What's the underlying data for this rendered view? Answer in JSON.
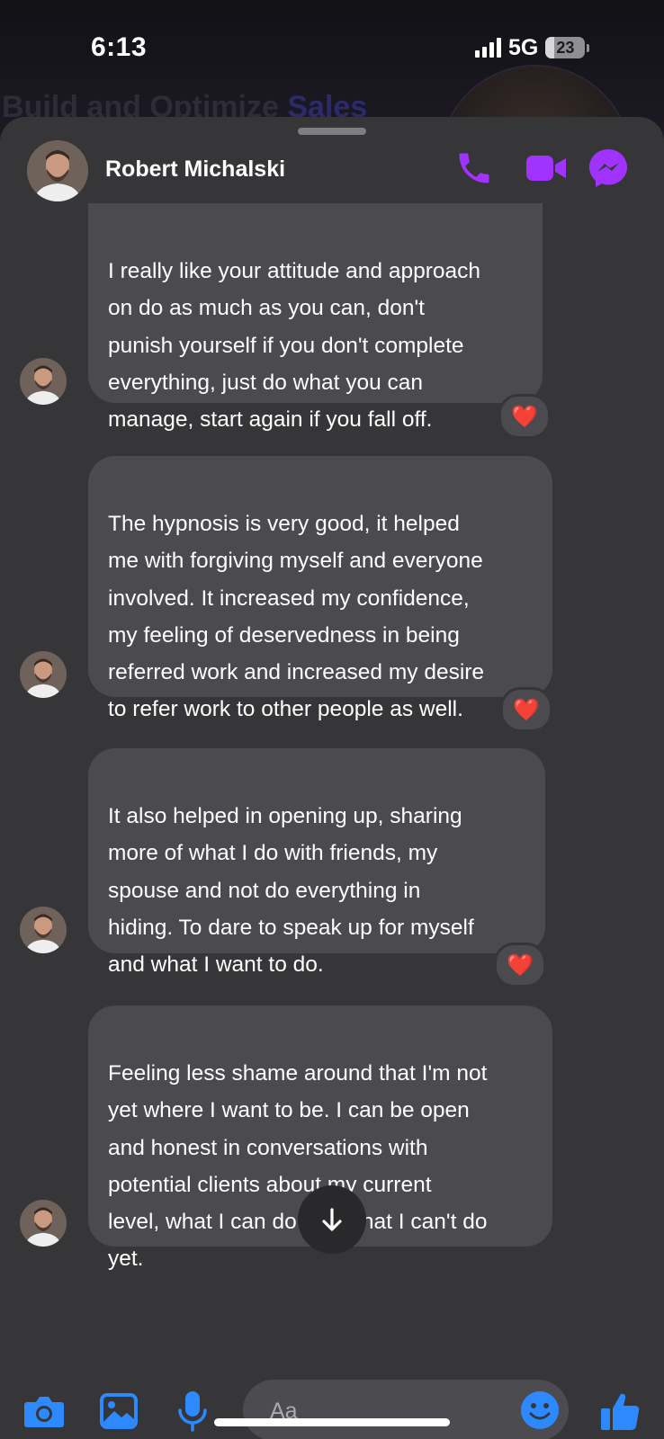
{
  "status_bar": {
    "time": "6:13",
    "network": "5G",
    "battery": "23",
    "battery_fraction": 0.23
  },
  "background_page": {
    "title_plain": "Build and Optimize ",
    "title_accent": "Sales"
  },
  "header": {
    "contact_name": "Robert Michalski"
  },
  "messages": [
    {
      "text": "I really like your attitude and approach\non do as much as you can, don't\npunish yourself if you don't complete\neverything, just do what you can\nmanage, start again if you fall off.",
      "reaction": "❤️"
    },
    {
      "text": "The hypnosis is very good, it helped\nme with forgiving myself and everyone\ninvolved. It increased my confidence,\nmy feeling of deservedness in being\nreferred work and increased my desire\nto refer work to other people as well.",
      "reaction": "❤️"
    },
    {
      "text": "It also helped in opening up, sharing\nmore of what I do with friends, my\nspouse and not do everything in\nhiding. To dare to speak up for myself\nand what I want to do.",
      "reaction": "❤️"
    },
    {
      "text": "Feeling less shame around that I'm not\nyet where I want to be. I can be open\nand honest in conversations  with\npotential clients about my current\nlevel, what I can do and what I can't do\nyet."
    }
  ],
  "composer": {
    "placeholder": "Aa"
  },
  "colors": {
    "accent_purple": "#a033ff",
    "accent_blue": "#2e89ff",
    "sheet": "#363639",
    "bubble": "#4a4a4f"
  }
}
